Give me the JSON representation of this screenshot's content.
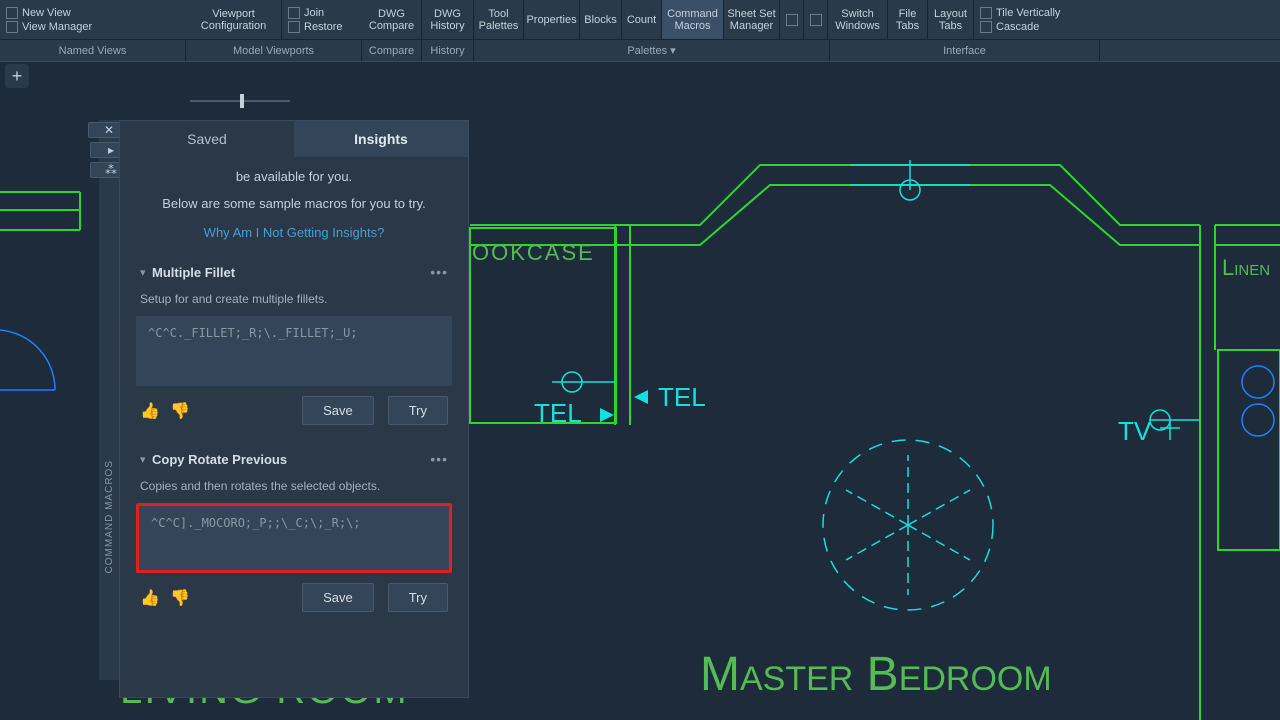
{
  "ribbon": {
    "new_view": "New View",
    "view_manager": "View Manager",
    "viewport_config": "Viewport\nConfiguration",
    "join": "Join",
    "restore": "Restore",
    "dwg_compare": "DWG\nCompare",
    "dwg_history": "DWG\nHistory",
    "tool_palettes": "Tool\nPalettes",
    "properties": "Properties",
    "blocks": "Blocks",
    "count": "Count",
    "command_macros": "Command\nMacros",
    "sheet_set": "Sheet Set\nManager",
    "switch_windows": "Switch\nWindows",
    "file_tabs": "File\nTabs",
    "layout_tabs": "Layout\nTabs",
    "tile_vertically": "Tile Vertically",
    "cascade": "Cascade"
  },
  "groups": {
    "named_views": "Named Views",
    "model_viewports": "Model Viewports",
    "compare": "Compare",
    "history": "History",
    "palettes": "Palettes ▾",
    "interface": "Interface"
  },
  "panel": {
    "tab_saved": "Saved",
    "tab_insights": "Insights",
    "intro1": "be available for you.",
    "intro2": "Below are some sample macros for you to try.",
    "help_link": "Why Am I Not Getting Insights?",
    "vlabel": "COMMAND MACROS"
  },
  "macro1": {
    "title": "Multiple Fillet",
    "desc": "Setup for and create multiple fillets.",
    "code": "^C^C._FILLET;_R;\\._FILLET;_U;",
    "save": "Save",
    "try": "Try"
  },
  "macro2": {
    "title": "Copy Rotate Previous",
    "desc": "Copies and then rotates the selected objects.",
    "code": "^C^C]._MOCORO;_P;;\\_C;\\;_R;\\;",
    "save": "Save",
    "try": "Try"
  },
  "drawing": {
    "bookcase": "OOKCASE",
    "tel1": "TEL",
    "tel2": "TEL",
    "tv": "TV",
    "liner": "LINEN",
    "master_bedroom": "MASTER BEDROOM",
    "living_room": "LIVING ROOM"
  },
  "chart_data": null
}
